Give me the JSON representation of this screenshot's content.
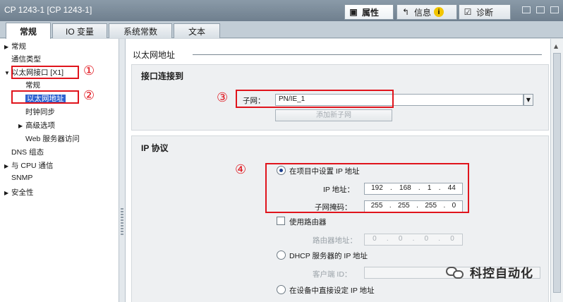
{
  "window": {
    "title": "CP 1243-1 [CP 1243-1]"
  },
  "inspector_tabs": [
    {
      "label": "属性",
      "icon": "properties-icon"
    },
    {
      "label": "信息",
      "icon": "info-icon"
    },
    {
      "label": "诊断",
      "icon": "diagnostics-icon"
    }
  ],
  "tabs": [
    "常规",
    "IO 变量",
    "系统常数",
    "文本"
  ],
  "nav": {
    "items": [
      {
        "label": "常规",
        "expander": "▶"
      },
      {
        "label": "通信类型"
      },
      {
        "label": "以太网接口 [X1]",
        "expander": "▼"
      },
      {
        "label": "常规"
      },
      {
        "label": "以太网地址"
      },
      {
        "label": "时钟同步"
      },
      {
        "label": "高级选项",
        "expander": "▶"
      },
      {
        "label": "Web 服务器访问"
      },
      {
        "label": "DNS 组态"
      },
      {
        "label": "与 CPU 通信",
        "expander": "▶"
      },
      {
        "label": "SNMP"
      },
      {
        "label": "安全性",
        "expander": "▶"
      }
    ]
  },
  "main": {
    "section_title": "以太网地址",
    "interface": {
      "title": "接口连接到",
      "subnet_label": "子网：",
      "subnet_value": "PN/IE_1",
      "add_subnet_button": "添加新子网"
    },
    "ip": {
      "title": "IP 协议",
      "set_in_project_label": "在项目中设置 IP 地址",
      "ip_address_label": "IP 地址：",
      "ip_address": [
        "192",
        "168",
        "1",
        "44"
      ],
      "subnet_mask_label": "子网掩码：",
      "subnet_mask": [
        "255",
        "255",
        "255",
        "0"
      ],
      "use_router_label": "使用路由器",
      "router_address_label": "路由器地址：",
      "router_address": [
        "0",
        "0",
        "0",
        "0"
      ],
      "dhcp_label": "DHCP 服务器的 IP 地址",
      "client_id_label": "客户端 ID：",
      "set_on_device_label": "在设备中直接设定 IP 地址"
    }
  },
  "annotations": [
    "①",
    "②",
    "③",
    "④"
  ],
  "watermark": {
    "text": "科控自动化"
  },
  "colors": {
    "annotation_red": "#e0141c",
    "selection_blue": "#2f63d1"
  }
}
